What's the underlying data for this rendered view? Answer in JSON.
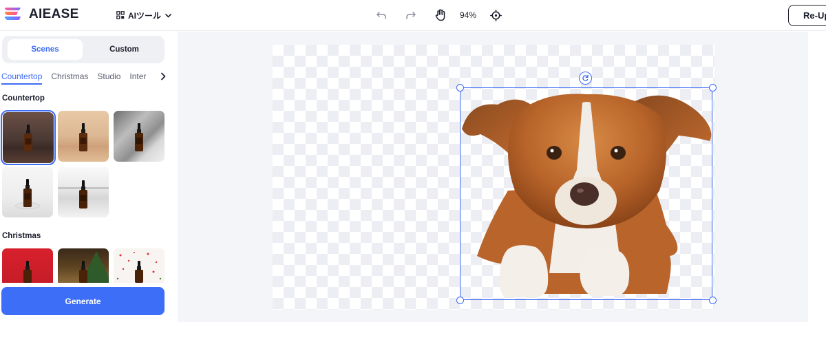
{
  "header": {
    "brand": "AIEASE",
    "tools_menu_label": "AIツール",
    "zoom_label": "94%",
    "reupload_label": "Re-Up"
  },
  "panel": {
    "segments": {
      "scenes": "Scenes",
      "custom": "Custom"
    },
    "category_tabs": [
      "Countertop",
      "Christmas",
      "Studio",
      "Inter"
    ],
    "sections": [
      {
        "title": "Countertop"
      },
      {
        "title": "Christmas"
      }
    ],
    "generate_label": "Generate"
  },
  "colors": {
    "accent": "#3b6cf6",
    "generate_button": "#3d6ef7"
  },
  "icons": {
    "undo": "undo-icon",
    "redo": "redo-icon",
    "hand": "hand-icon",
    "target": "locate-icon",
    "grid": "grid-icon",
    "chevron": "chevron-down-icon",
    "rotate": "rotate-icon"
  }
}
